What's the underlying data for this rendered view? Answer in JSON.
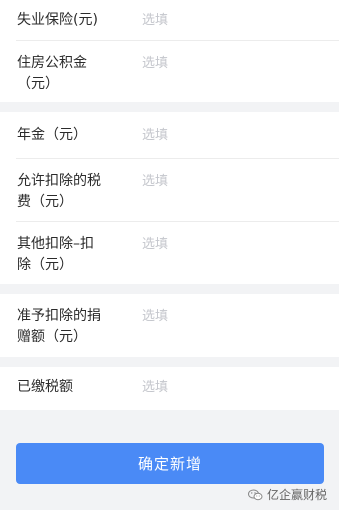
{
  "form": {
    "group1": [
      {
        "label": "失业保险(元)",
        "placeholder": "选填"
      },
      {
        "label": "住房公积金\n（元）",
        "placeholder": "选填"
      }
    ],
    "group2": [
      {
        "label": "年金（元）",
        "placeholder": "选填"
      },
      {
        "label": "允许扣除的税\n费（元）",
        "placeholder": "选填"
      },
      {
        "label": "其他扣除–扣\n除（元）",
        "placeholder": "选填"
      }
    ],
    "group3": [
      {
        "label": "准予扣除的捐\n赠额（元）",
        "placeholder": "选填"
      }
    ],
    "group4": [
      {
        "label": "已缴税额",
        "placeholder": "选填"
      }
    ]
  },
  "submit_label": "确定新增",
  "watermark": {
    "text": "亿企赢财税",
    "icon": "wechat-icon"
  },
  "colors": {
    "primary": "#4a8af6",
    "placeholder": "#c4c6cc",
    "background": "#f2f3f5"
  }
}
